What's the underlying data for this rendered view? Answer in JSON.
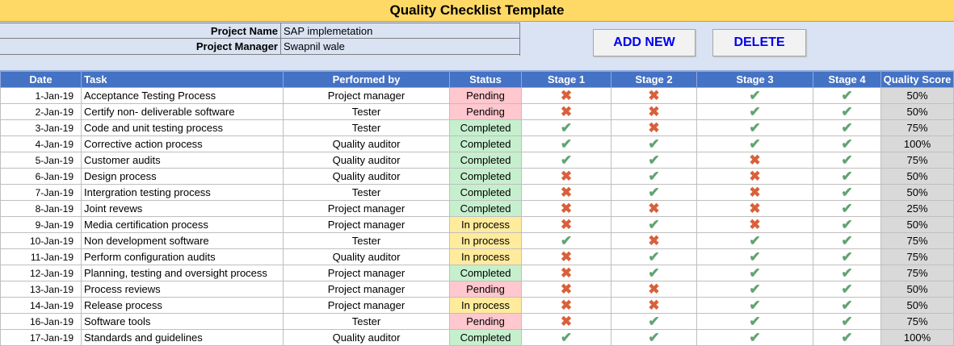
{
  "title": "Quality Checklist Template",
  "project": {
    "name_label": "Project Name",
    "name_value": "SAP implemetation",
    "manager_label": "Project Manager",
    "manager_value": "Swapnil wale"
  },
  "buttons": {
    "add": "ADD NEW",
    "delete": "DELETE"
  },
  "columns": [
    "Date",
    "Task",
    "Performed by",
    "Status",
    "Stage 1",
    "Stage 2",
    "Stage 3",
    "Stage 4",
    "Quality Score"
  ],
  "icons": {
    "pass": "check-icon",
    "fail": "cross-icon"
  },
  "colors": {
    "header": "#4472c4",
    "title": "#ffd966",
    "pending": "#ffc7ce",
    "completed": "#c6efce",
    "in_process": "#ffeb9c"
  },
  "rows": [
    {
      "date": "1-Jan-19",
      "task": "Acceptance Testing Process",
      "by": "Project manager",
      "status": "Pending",
      "stages": [
        0,
        0,
        1,
        1
      ],
      "score": "50%"
    },
    {
      "date": "2-Jan-19",
      "task": "Certify non- deliverable software",
      "by": "Tester",
      "status": "Pending",
      "stages": [
        0,
        0,
        1,
        1
      ],
      "score": "50%"
    },
    {
      "date": "3-Jan-19",
      "task": "Code and unit testing process",
      "by": "Tester",
      "status": "Completed",
      "stages": [
        1,
        0,
        1,
        1
      ],
      "score": "75%"
    },
    {
      "date": "4-Jan-19",
      "task": "Corrective action process",
      "by": "Quality auditor",
      "status": "Completed",
      "stages": [
        1,
        1,
        1,
        1
      ],
      "score": "100%"
    },
    {
      "date": "5-Jan-19",
      "task": "Customer audits",
      "by": "Quality auditor",
      "status": "Completed",
      "stages": [
        1,
        1,
        0,
        1
      ],
      "score": "75%"
    },
    {
      "date": "6-Jan-19",
      "task": "Design process",
      "by": "Quality auditor",
      "status": "Completed",
      "stages": [
        0,
        1,
        0,
        1
      ],
      "score": "50%"
    },
    {
      "date": "7-Jan-19",
      "task": "Intergration testing process",
      "by": "Tester",
      "status": "Completed",
      "stages": [
        0,
        1,
        0,
        1
      ],
      "score": "50%"
    },
    {
      "date": "8-Jan-19",
      "task": "Joint revews",
      "by": "Project manager",
      "status": "Completed",
      "stages": [
        0,
        0,
        0,
        1
      ],
      "score": "25%"
    },
    {
      "date": "9-Jan-19",
      "task": "Media certification process",
      "by": "Project manager",
      "status": "In process",
      "stages": [
        0,
        1,
        0,
        1
      ],
      "score": "50%"
    },
    {
      "date": "10-Jan-19",
      "task": "Non development software",
      "by": "Tester",
      "status": "In process",
      "stages": [
        1,
        0,
        1,
        1
      ],
      "score": "75%"
    },
    {
      "date": "11-Jan-19",
      "task": "Perform configuration audits",
      "by": "Quality auditor",
      "status": "In process",
      "stages": [
        0,
        1,
        1,
        1
      ],
      "score": "75%"
    },
    {
      "date": "12-Jan-19",
      "task": "Planning, testing and oversight process",
      "by": "Project manager",
      "status": "Completed",
      "stages": [
        0,
        1,
        1,
        1
      ],
      "score": "75%"
    },
    {
      "date": "13-Jan-19",
      "task": "Process reviews",
      "by": "Project manager",
      "status": "Pending",
      "stages": [
        0,
        0,
        1,
        1
      ],
      "score": "50%"
    },
    {
      "date": "14-Jan-19",
      "task": "Release process",
      "by": "Project manager",
      "status": "In process",
      "stages": [
        0,
        0,
        1,
        1
      ],
      "score": "50%"
    },
    {
      "date": "16-Jan-19",
      "task": "Software tools",
      "by": "Tester",
      "status": "Pending",
      "stages": [
        0,
        1,
        1,
        1
      ],
      "score": "75%"
    },
    {
      "date": "17-Jan-19",
      "task": "Standards and guidelines",
      "by": "Quality auditor",
      "status": "Completed",
      "stages": [
        1,
        1,
        1,
        1
      ],
      "score": "100%"
    }
  ]
}
